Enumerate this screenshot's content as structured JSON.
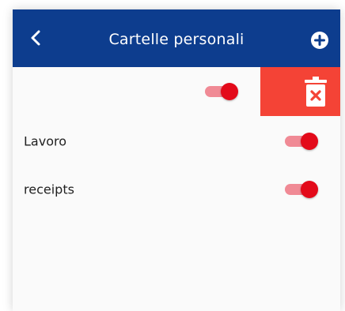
{
  "header": {
    "title": "Cartelle personali",
    "back_icon": "chevron-left-icon",
    "add_icon": "plus-circle-icon"
  },
  "folders": [
    {
      "label": "",
      "enabled": true,
      "swiped": true
    },
    {
      "label": "Lavoro",
      "enabled": true,
      "swiped": false
    },
    {
      "label": "receipts",
      "enabled": true,
      "swiped": false
    }
  ],
  "swipe_action": {
    "icon": "trash-icon"
  },
  "colors": {
    "appbar": "#0d3d8e",
    "delete": "#f44336",
    "toggle_thumb": "#e30a1a",
    "toggle_track": "#f08a95"
  }
}
